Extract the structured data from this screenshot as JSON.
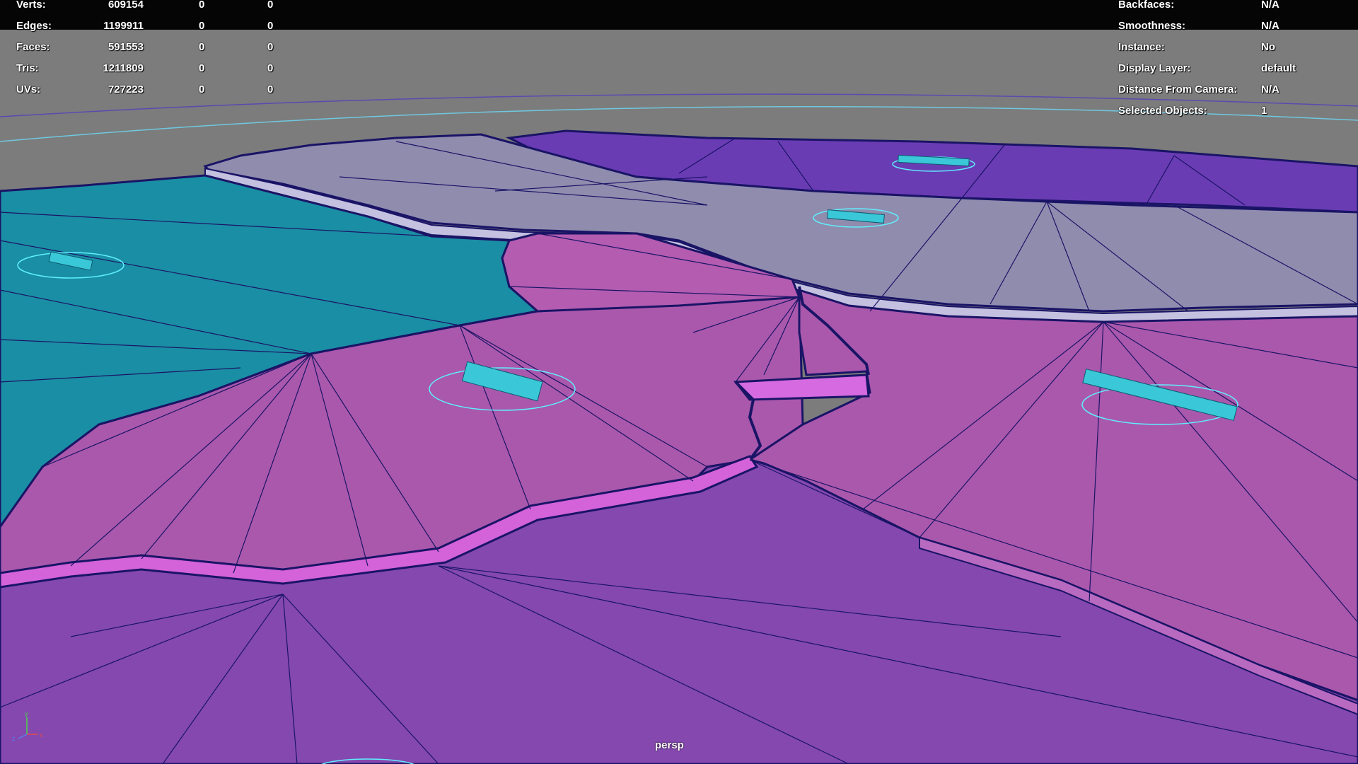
{
  "hud_stats": {
    "rows": [
      {
        "label": "Verts:",
        "total": "609154",
        "selected": "0",
        "components": "0"
      },
      {
        "label": "Edges:",
        "total": "1199911",
        "selected": "0",
        "components": "0"
      },
      {
        "label": "Faces:",
        "total": "591553",
        "selected": "0",
        "components": "0"
      },
      {
        "label": "Tris:",
        "total": "1211809",
        "selected": "0",
        "components": "0"
      },
      {
        "label": "UVs:",
        "total": "727223",
        "selected": "0",
        "components": "0"
      }
    ]
  },
  "hud_object": {
    "rows": [
      {
        "label": "Backfaces:",
        "value": "N/A"
      },
      {
        "label": "Smoothness:",
        "value": "N/A"
      },
      {
        "label": "Instance:",
        "value": "No"
      },
      {
        "label": "Display Layer:",
        "value": "default"
      },
      {
        "label": "Distance From Camera:",
        "value": "N/A"
      },
      {
        "label": "Selected Objects:",
        "value": "1"
      }
    ]
  },
  "viewport": {
    "camera_name": "persp",
    "background_color": "#7c7c7c",
    "wireframe_color": "#1a1466",
    "selection_color": "#5ef0ff",
    "axis_labels": {
      "x": "x",
      "y": "y",
      "z": "z"
    }
  },
  "regions": {
    "teal": "#1a8ea4",
    "light_purple_gray": "#908cae",
    "deep_violet": "#6a3cb4",
    "magenta": "#aa58ac",
    "foreground_violet": "#8448ae"
  }
}
